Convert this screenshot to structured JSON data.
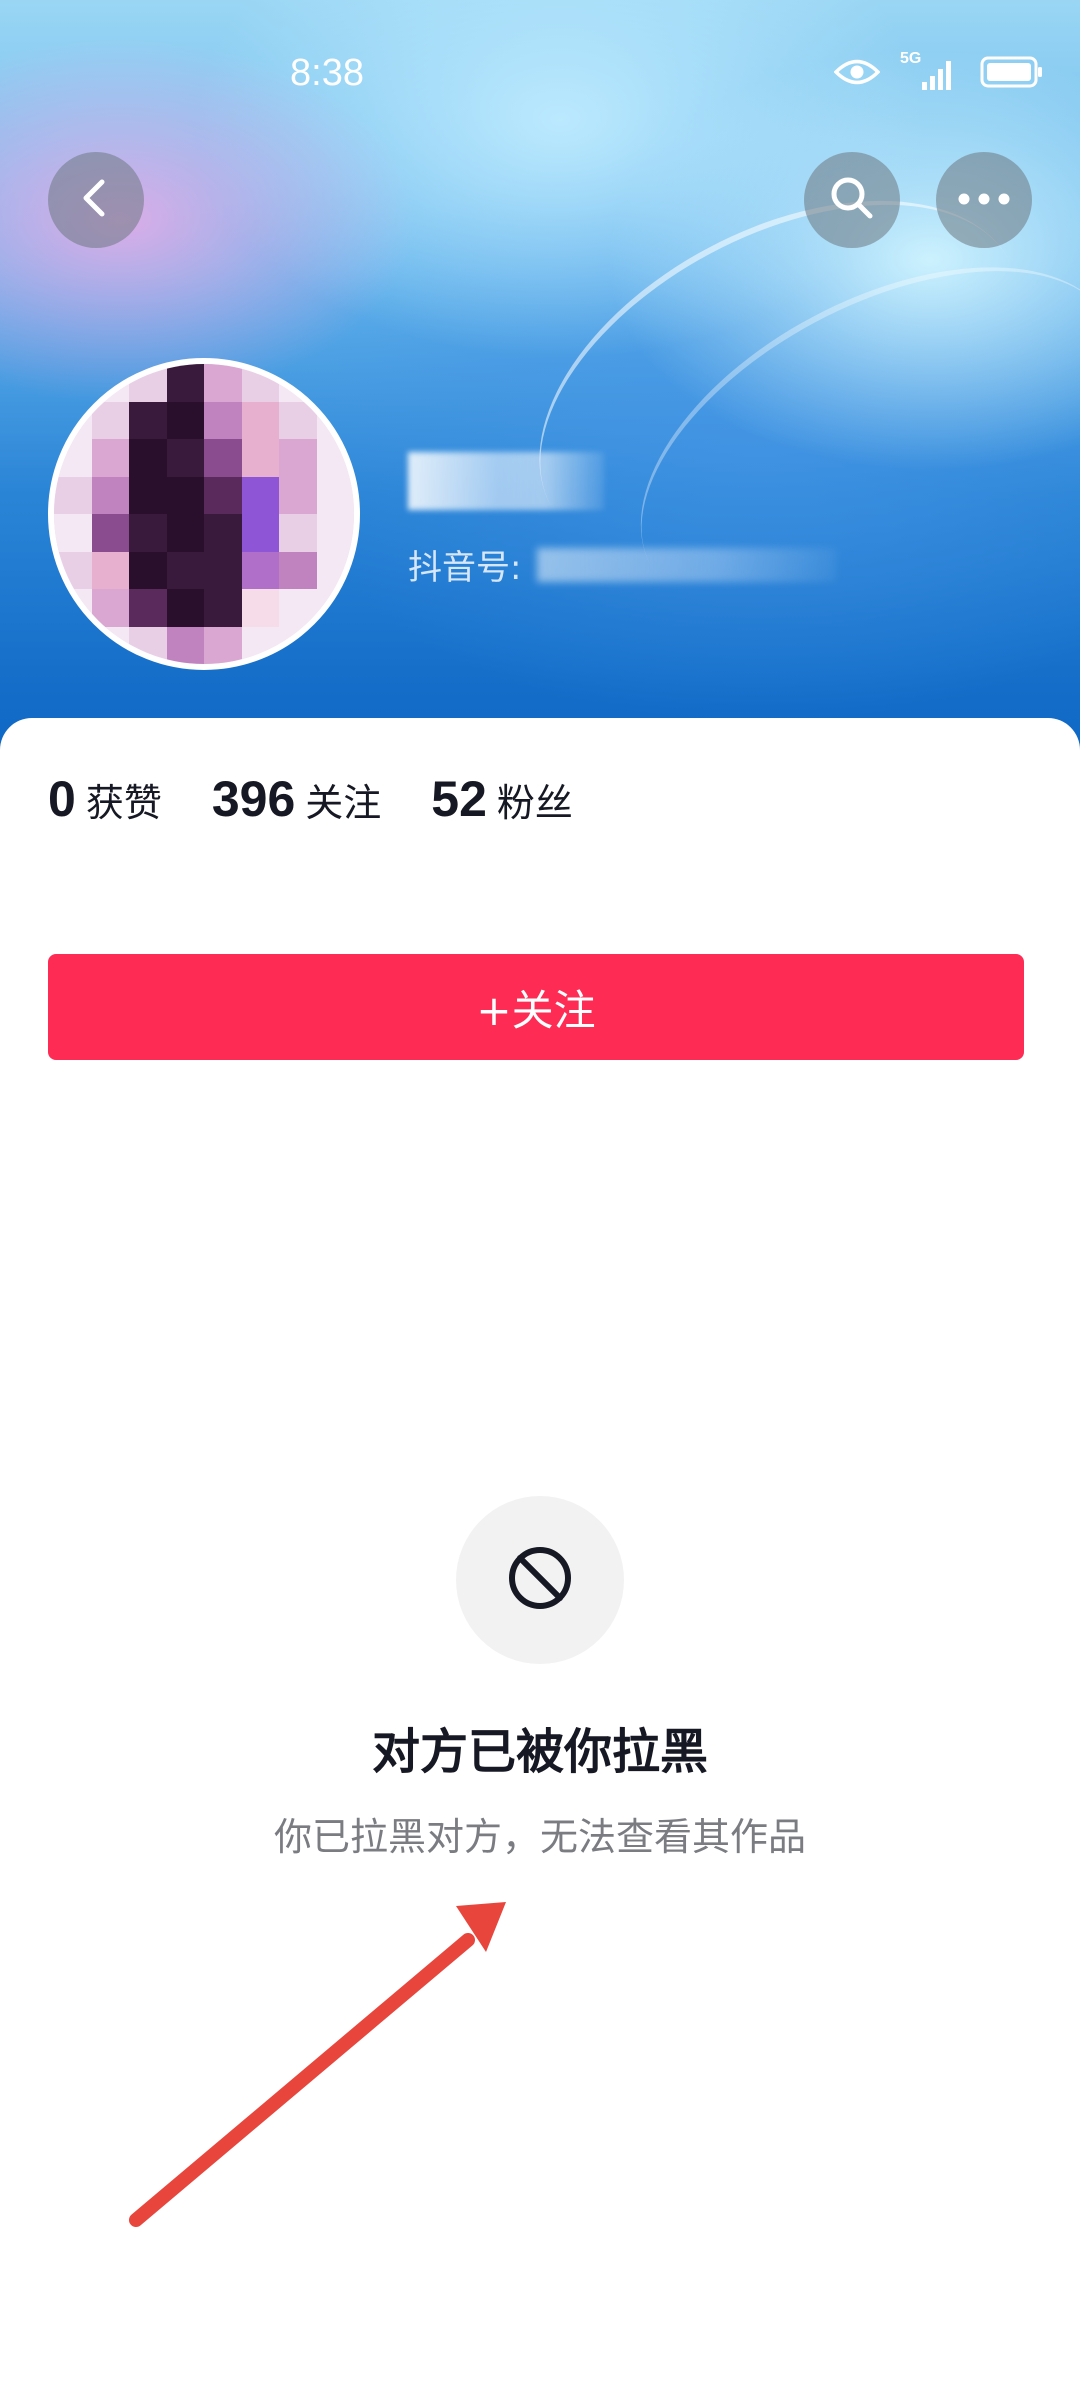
{
  "status_bar": {
    "time": "8:38",
    "network_label": "5G"
  },
  "header": {
    "back_icon": "chevron-left-icon",
    "search_icon": "search-icon",
    "more_icon": "more-horizontal-icon"
  },
  "profile": {
    "douyin_id_label": "抖音号:"
  },
  "stats": [
    {
      "value": "0",
      "label": "获赞"
    },
    {
      "value": "396",
      "label": "关注"
    },
    {
      "value": "52",
      "label": "粉丝"
    }
  ],
  "follow_button": {
    "label": "+关注",
    "color": "#fe2c55"
  },
  "blocked_state": {
    "icon": "prohibited-icon",
    "title": "对方已被你拉黑",
    "subtitle": "你已拉黑对方，无法查看其作品"
  },
  "annotation": {
    "icon": "red-arrow-icon",
    "color": "#e8453c"
  }
}
